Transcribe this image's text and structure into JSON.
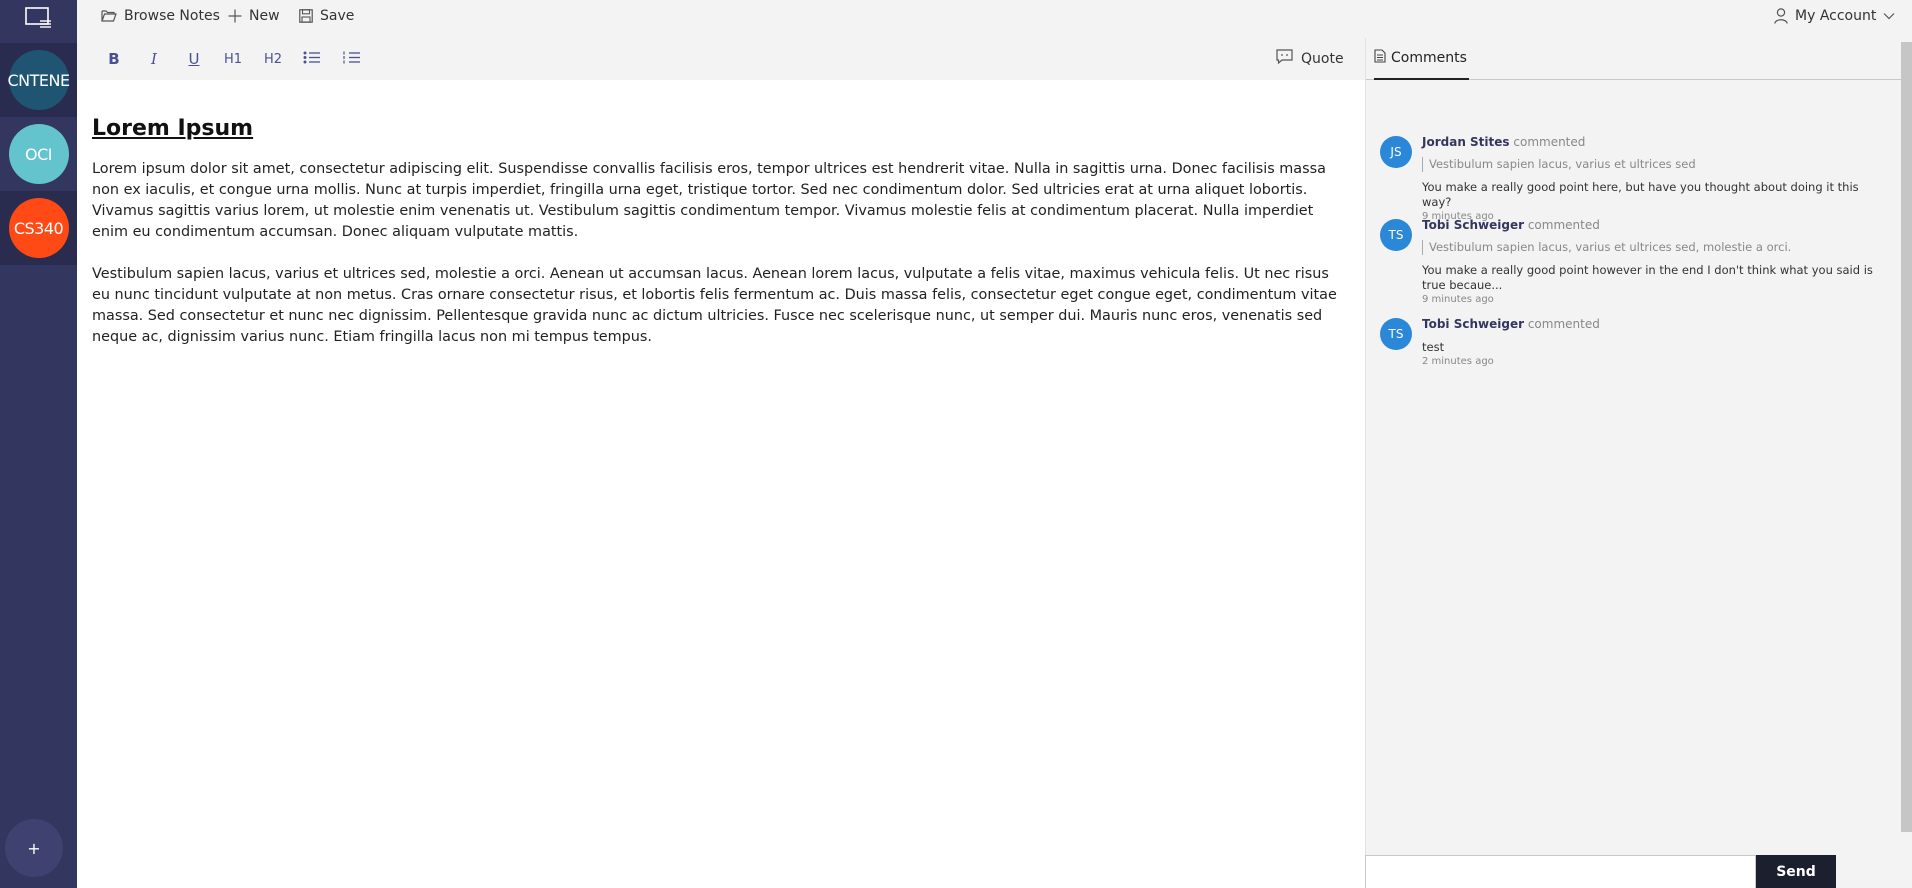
{
  "rail": {
    "logo_icon": "note-folder-icon",
    "notebooks": [
      {
        "label": "CNTENE",
        "color": "#1f5472"
      },
      {
        "label": "OCI",
        "color": "#64c4ce"
      },
      {
        "label": "CS340",
        "color": "#ff4a16"
      }
    ],
    "add_label": "+"
  },
  "topbar": {
    "browse_label": "Browse Notes",
    "new_label": "New",
    "save_label": "Save",
    "account_label": "My Account"
  },
  "toolbar": {
    "bold": "B",
    "italic": "I",
    "underline": "U",
    "h1": "H1",
    "h2": "H2",
    "quote_label": "Quote"
  },
  "document": {
    "title": "Lorem Ipsum",
    "paragraphs": [
      "Lorem ipsum dolor sit amet, consectetur adipiscing elit. Suspendisse convallis facilisis eros, tempor ultrices est hendrerit vitae. Nulla in sagittis urna. Donec facilisis massa non ex iaculis, et congue urna mollis. Nunc at turpis imperdiet, fringilla urna eget, tristique tortor. Sed nec condimentum dolor. Sed ultricies erat at urna aliquet lobortis. Vivamus sagittis varius lorem, ut molestie enim venenatis ut. Vestibulum sagittis condimentum tempor. Vivamus molestie felis at condimentum placerat. Nulla imperdiet enim eu condimentum accumsan. Donec aliquam vulputate mattis.",
      "Vestibulum sapien lacus, varius et ultrices sed, molestie a orci. Aenean ut accumsan lacus. Aenean lorem lacus, vulputate a felis vitae, maximus vehicula felis. Ut nec risus eu nunc tincidunt vulputate at non metus. Cras ornare consectetur risus, et lobortis felis fermentum ac. Duis massa felis, consectetur eget congue eget, condimentum vitae massa. Sed consectetur et nunc nec dignissim. Pellentesque gravida nunc ac dictum ultricies. Fusce nec scelerisque nunc, ut semper dui. Mauris nunc eros, venenatis sed neque ac, dignissim varius nunc. Etiam fringilla lacus non mi tempus tempus."
    ]
  },
  "comments": {
    "tab_label": "Comments",
    "items": [
      {
        "initials": "JS",
        "author": "Jordan Stites",
        "action": "commented",
        "quote": "Vestibulum sapien lacus, varius et ultrices sed",
        "text": "You make a really good point here, but have you thought about doing it this way?",
        "time": "9 minutes ago"
      },
      {
        "initials": "TS",
        "author": "Tobi Schweiger",
        "action": "commented",
        "quote": "Vestibulum sapien lacus, varius et ultrices sed, molestie a orci.",
        "text": "You make a really good point however in the end I don't think what you said is true becaue...",
        "time": "9 minutes ago"
      },
      {
        "initials": "TS",
        "author": "Tobi Schweiger",
        "action": "commented",
        "quote": "",
        "text": "test",
        "time": "2 minutes ago"
      }
    ],
    "input_placeholder": "",
    "send_label": "Send"
  },
  "colors": {
    "rail_bg": "#33365f",
    "accent": "#4a5095",
    "avatar": "#2b88d8",
    "send_bg": "#1b1f2e"
  }
}
